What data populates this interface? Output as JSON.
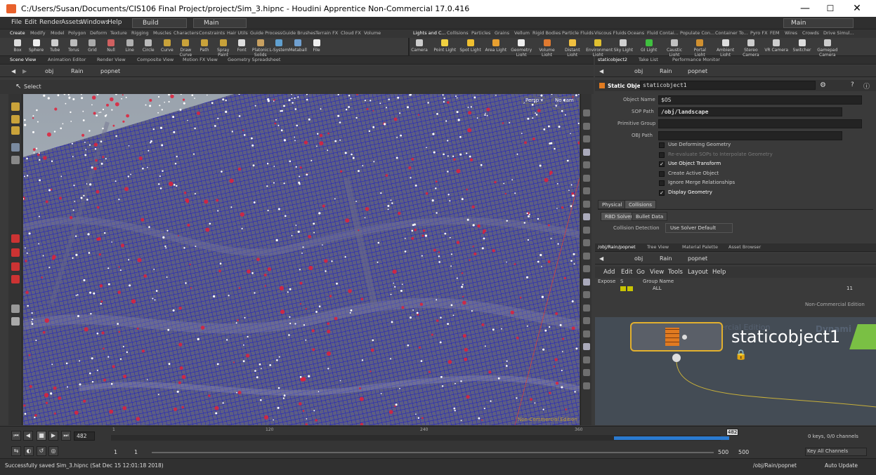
{
  "window": {
    "title": "C:/Users/Susan/Documents/CIS106 Final Project/project/Sim_3.hipnc - Houdini Apprentice Non-Commercial 17.0.416",
    "minimize": "—",
    "maximize": "☐",
    "close": "✕"
  },
  "menu": {
    "items": [
      "File",
      "Edit",
      "Render",
      "Assets",
      "Windows",
      "Help"
    ],
    "build_desktop": "Build",
    "main_desktop": "Main",
    "right_main": "Main"
  },
  "shelf_left": {
    "tabs": [
      "Create",
      "Modify",
      "Model",
      "Polygon",
      "Deform",
      "Texture",
      "Rigging",
      "Muscles",
      "Characters",
      "Constraints",
      "Hair Utils",
      "Guide Process",
      "Guide Brushes",
      "Terrain FX",
      "Cloud FX",
      "Volume"
    ],
    "tools": [
      "Box",
      "Sphere",
      "Tube",
      "Torus",
      "Grid",
      "Null",
      "Line",
      "Circle",
      "Curve",
      "Draw Curve",
      "Path",
      "Spray Paint",
      "Font",
      "Platonic Solids",
      "L-System",
      "Metaball",
      "File"
    ]
  },
  "shelf_right": {
    "tabs": [
      "Lights and C...",
      "Collisions",
      "Particles",
      "Grains",
      "Vellum",
      "Rigid Bodies",
      "Particle Fluids",
      "Viscous Fluids",
      "Oceans",
      "Fluid Contai...",
      "Populate Con...",
      "Container To...",
      "Pyro FX",
      "FEM",
      "Wires",
      "Crowds",
      "Drive Simul..."
    ],
    "tools": [
      "Camera",
      "Point Light",
      "Spot Light",
      "Area Light",
      "Geometry Light",
      "Volume Light",
      "Distant Light",
      "Environment Light",
      "Sky Light",
      "GI Light",
      "Caustic Light",
      "Portal Light",
      "Ambient Light",
      "Stereo Camera",
      "VR Camera",
      "Switcher",
      "Gamepad Camera"
    ]
  },
  "viewer": {
    "tabs": [
      "Scene View",
      "Animation Editor",
      "Render View",
      "Composite View",
      "Motion FX View",
      "Geometry Spreadsheet"
    ],
    "path": [
      "obj",
      "Rain",
      "popnet"
    ],
    "select_label": "Select",
    "persp": "Persp ▾",
    "cam": "No cam ▾",
    "watermark": "Non-Commercial Edition"
  },
  "params": {
    "tabs": [
      "staticobject2",
      "Take List",
      "Performance Monitor"
    ],
    "path": [
      "obj",
      "Rain",
      "popnet"
    ],
    "node_type": "Static Object",
    "node_name": "staticobject1",
    "object_name_label": "Object Name",
    "object_name_value": "$OS",
    "sop_path_label": "SOP Path",
    "sop_path_value": "/obj/landscape",
    "primitive_group_label": "Primitive Group",
    "obj_path_label": "OBJ Path",
    "checks": [
      {
        "label": "Use Deforming Geometry",
        "checked": false,
        "dim": false
      },
      {
        "label": "Re-evaluate SOPs to Interpolate Geometry",
        "checked": false,
        "dim": true
      },
      {
        "label": "Use Object Transform",
        "checked": true,
        "dim": false
      },
      {
        "label": "Create Active Object",
        "checked": false,
        "dim": false
      },
      {
        "label": "Ignore Merge Relationships",
        "checked": false,
        "dim": false
      },
      {
        "label": "Display Geometry",
        "checked": true,
        "dim": false
      }
    ],
    "main_tabs": [
      "Physical",
      "Collisions"
    ],
    "sub_tabs": [
      "RBD Solver",
      "Bullet Data"
    ],
    "collision_detection_label": "Collision Detection",
    "collision_detection_value": "Use Solver Default"
  },
  "network": {
    "tabs": [
      "/obj/Rain/popnet",
      "Tree View",
      "Material Palette",
      "Asset Browser"
    ],
    "path": [
      "obj",
      "Rain",
      "popnet"
    ],
    "menu": [
      "Add",
      "Edit",
      "Go",
      "View",
      "Tools",
      "Layout",
      "Help"
    ],
    "group_headers": [
      "Expose",
      "S",
      "Group Name"
    ],
    "group_row": "ALL",
    "group_count": "11",
    "watermark": "Non-Commercial Edition",
    "bg_text_1": "ercial Edition",
    "bg_text_2": "Dynami",
    "node_label": "staticobject1"
  },
  "timeline": {
    "frame": "482",
    "ticks": [
      "1",
      "120",
      "240",
      "360"
    ],
    "marker": "482",
    "start": "1",
    "start2": "1",
    "end": "500",
    "end2": "500",
    "keys_info": "0 keys, 0/0 channels",
    "key_all": "Key All Channels"
  },
  "status": {
    "message": "Successfully saved Sim_3.hipnc (Sat Dec 15 12:01:18 2018)",
    "path": "/obj/Rain/popnet",
    "update": "Auto Update"
  },
  "colors": {
    "accent": "#f0a030",
    "mesh_blue": "#2a2ad8",
    "particle_red": "#e0203a"
  }
}
